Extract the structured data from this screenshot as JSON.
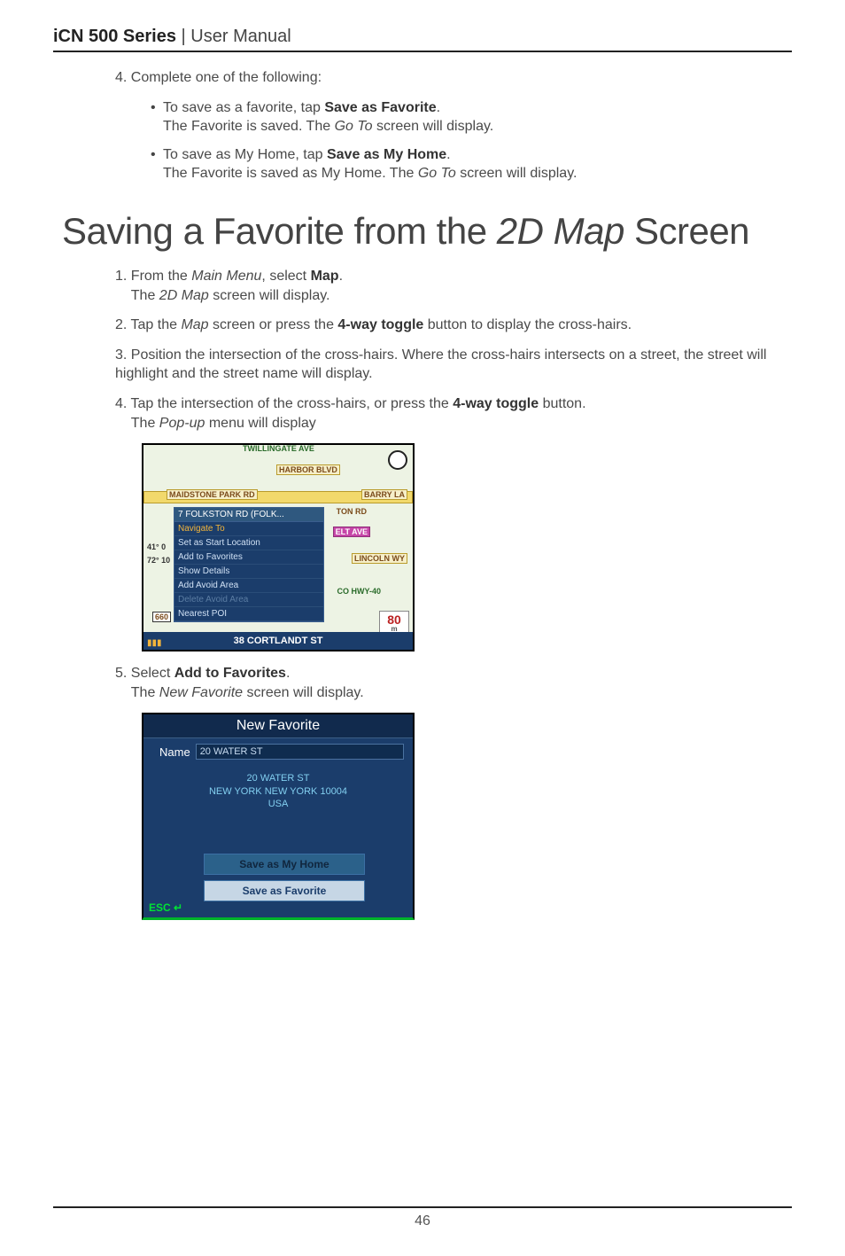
{
  "header": {
    "product": "iCN 500 Series",
    "separator": " | ",
    "subtitle": "User Manual"
  },
  "step4_intro": "4. Complete one of the following:",
  "step4_bullets": [
    {
      "line1_pre": "To save as a favorite, tap ",
      "line1_bold": "Save as Favorite",
      "line1_post": ".",
      "line2_pre": "The Favorite is saved. The ",
      "line2_italic": "Go To",
      "line2_post": " screen will display."
    },
    {
      "line1_pre": "To save as My Home, tap ",
      "line1_bold": "Save as My Home",
      "line1_post": ".",
      "line2_pre": "The Favorite is saved as My Home. The ",
      "line2_italic": "Go To",
      "line2_post": " screen will display."
    }
  ],
  "section_title_pre": "Saving a Favorite from the ",
  "section_title_italic": "2D Map",
  "section_title_post": " Screen",
  "steps": {
    "s1_num": "1. ",
    "s1_pre": "From the ",
    "s1_it": "Main Menu",
    "s1_mid": ", select ",
    "s1_bold": "Map",
    "s1_post": ".",
    "s1_l2_pre": "The ",
    "s1_l2_it": "2D Map",
    "s1_l2_post": " screen will display.",
    "s2_num": "2. ",
    "s2_pre": "Tap the ",
    "s2_it": "Map",
    "s2_mid": " screen or press the ",
    "s2_bold": "4-way toggle",
    "s2_post": " button to display the cross-hairs.",
    "s3_num": "3. ",
    "s3_text": "Position the intersection of the cross-hairs. Where the cross-hairs intersects on a street, the street will highlight and the street name will display.",
    "s4_num": "4. ",
    "s4_pre": "Tap the intersection of the cross-hairs, or press the ",
    "s4_bold": "4-way toggle",
    "s4_post": " button.",
    "s4_l2_pre": "The ",
    "s4_l2_it": "Pop-up",
    "s4_l2_post": " menu will display",
    "s5_num": "5. ",
    "s5_pre": "Select ",
    "s5_bold": "Add to Favorites",
    "s5_post": ".",
    "s5_l2_pre": "The ",
    "s5_l2_it": "New Favorite",
    "s5_l2_post": " screen will display."
  },
  "map": {
    "labels": {
      "twillingate": "TWILLINGATE AVE",
      "harbor": "HARBOR BLVD",
      "maidstone": "MAIDSTONE PARK RD",
      "barry": "BARRY LA",
      "ton": "TON RD",
      "elt": "ELT AVE",
      "lincoln": "LINCOLN WY",
      "hwy": "CO HWY-40",
      "six60": "660"
    },
    "popup_title": "7 FOLKSTON RD (FOLK...",
    "popup_items": {
      "navigate": "Navigate To",
      "setstart": "Set as Start Location",
      "addfav": "Add to Favorites",
      "details": "Show Details",
      "addavoid": "Add Avoid Area",
      "delavoid": "Delete Avoid Area",
      "nearest": "Nearest POI"
    },
    "coords": {
      "lat": "41° 0",
      "lon": "72° 10"
    },
    "bottom_street": "38 CORTLANDT ST",
    "distance": "80",
    "distance_unit": "m"
  },
  "newfav": {
    "title": "New Favorite",
    "name_label": "Name",
    "name_value": "20 WATER ST",
    "addr1": "20 WATER ST",
    "addr2": "NEW YORK NEW YORK 10004",
    "addr3": "USA",
    "btn_home": "Save as My Home",
    "btn_fav": "Save as Favorite",
    "esc": "ESC ↵"
  },
  "page_number": "46"
}
